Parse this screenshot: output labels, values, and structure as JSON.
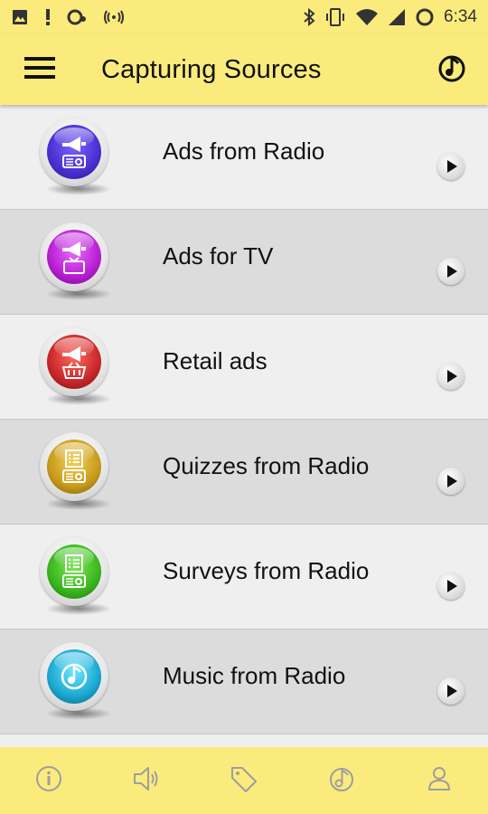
{
  "status_bar": {
    "time": "6:34",
    "icons": [
      "image-icon",
      "alert-icon",
      "voicemail-icon",
      "cast-icon",
      "bluetooth-icon",
      "vibrate-icon",
      "wifi-icon",
      "signal-icon",
      "battery-ring-icon"
    ]
  },
  "app_bar": {
    "title": "Capturing Sources",
    "menu_icon": "hamburger-icon",
    "action_icon": "music-note-icon"
  },
  "colors": {
    "app_bar": "#fbeb7d",
    "row_light": "#efefef",
    "row_dark": "#dcdcdc",
    "nav_icon": "#9e9e9e"
  },
  "list": {
    "items": [
      {
        "label": "Ads from Radio",
        "icon": "megaphone-radio-icon",
        "color": "#4a2fd0"
      },
      {
        "label": "Ads for TV",
        "icon": "megaphone-tv-icon",
        "color": "#b61ed0"
      },
      {
        "label": "Retail ads",
        "icon": "megaphone-basket-icon",
        "color": "#c8262a"
      },
      {
        "label": "Quizzes from Radio",
        "icon": "checklist-radio-icon",
        "color": "#c79a1a"
      },
      {
        "label": "Surveys from Radio",
        "icon": "checklist-radio-icon",
        "color": "#39b51c"
      },
      {
        "label": "Music from Radio",
        "icon": "music-note-icon",
        "color": "#1aa7d0"
      }
    ]
  },
  "bottom_nav": {
    "items": [
      "info-icon",
      "speaker-icon",
      "tag-icon",
      "music-note-icon",
      "person-icon"
    ]
  }
}
